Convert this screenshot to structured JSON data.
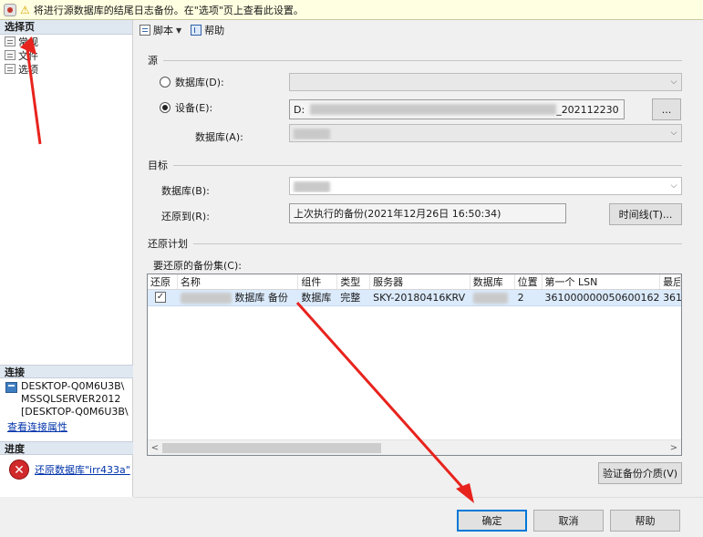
{
  "warning_bar": {
    "text": "将进行源数据库的结尾日志备份。在\"选项\"页上查看此设置。"
  },
  "left_panel": {
    "header": "选择页",
    "pages": [
      {
        "label": "常规"
      },
      {
        "label": "文件"
      },
      {
        "label": "选项"
      }
    ],
    "connection": {
      "header": "连接",
      "lines": [
        "DESKTOP-Q0M6U3B\\",
        "MSSQLSERVER2012",
        "[DESKTOP-Q0M6U3B\\"
      ],
      "link": "查看连接属性"
    },
    "progress": {
      "header": "进度",
      "link": "还原数据库\"irr433a\""
    }
  },
  "toolbar": {
    "script": "脚本",
    "help": "帮助"
  },
  "source": {
    "title": "源",
    "database_radio": "数据库(D):",
    "device_radio": "设备(E):",
    "device_value_prefix": "D:",
    "device_value_suffix": "_202112230",
    "browse_button": "...",
    "database_label": "数据库(A):"
  },
  "target": {
    "title": "目标",
    "database_label": "数据库(B):",
    "restore_to_label": "还原到(R):",
    "restore_to_value": "上次执行的备份(2021年12月26日 16:50:34)",
    "timeline_button": "时间线(T)..."
  },
  "plan": {
    "title": "还原计划",
    "backup_sets_label": "要还原的备份集(C):",
    "columns": [
      "还原",
      "名称",
      "组件",
      "类型",
      "服务器",
      "数据库",
      "位置",
      "第一个 LSN",
      "最后"
    ],
    "rows": [
      {
        "restore": true,
        "name_suffix": "数据库 备份",
        "component": "数据库",
        "type": "完整",
        "server": "SKY-20180416KRV",
        "database": "",
        "position": "2",
        "first_lsn": "361000000050600162",
        "last": "361"
      }
    ],
    "verify_button": "验证备份介质(V)"
  },
  "footer": {
    "ok": "确定",
    "cancel": "取消",
    "help": "帮助"
  }
}
